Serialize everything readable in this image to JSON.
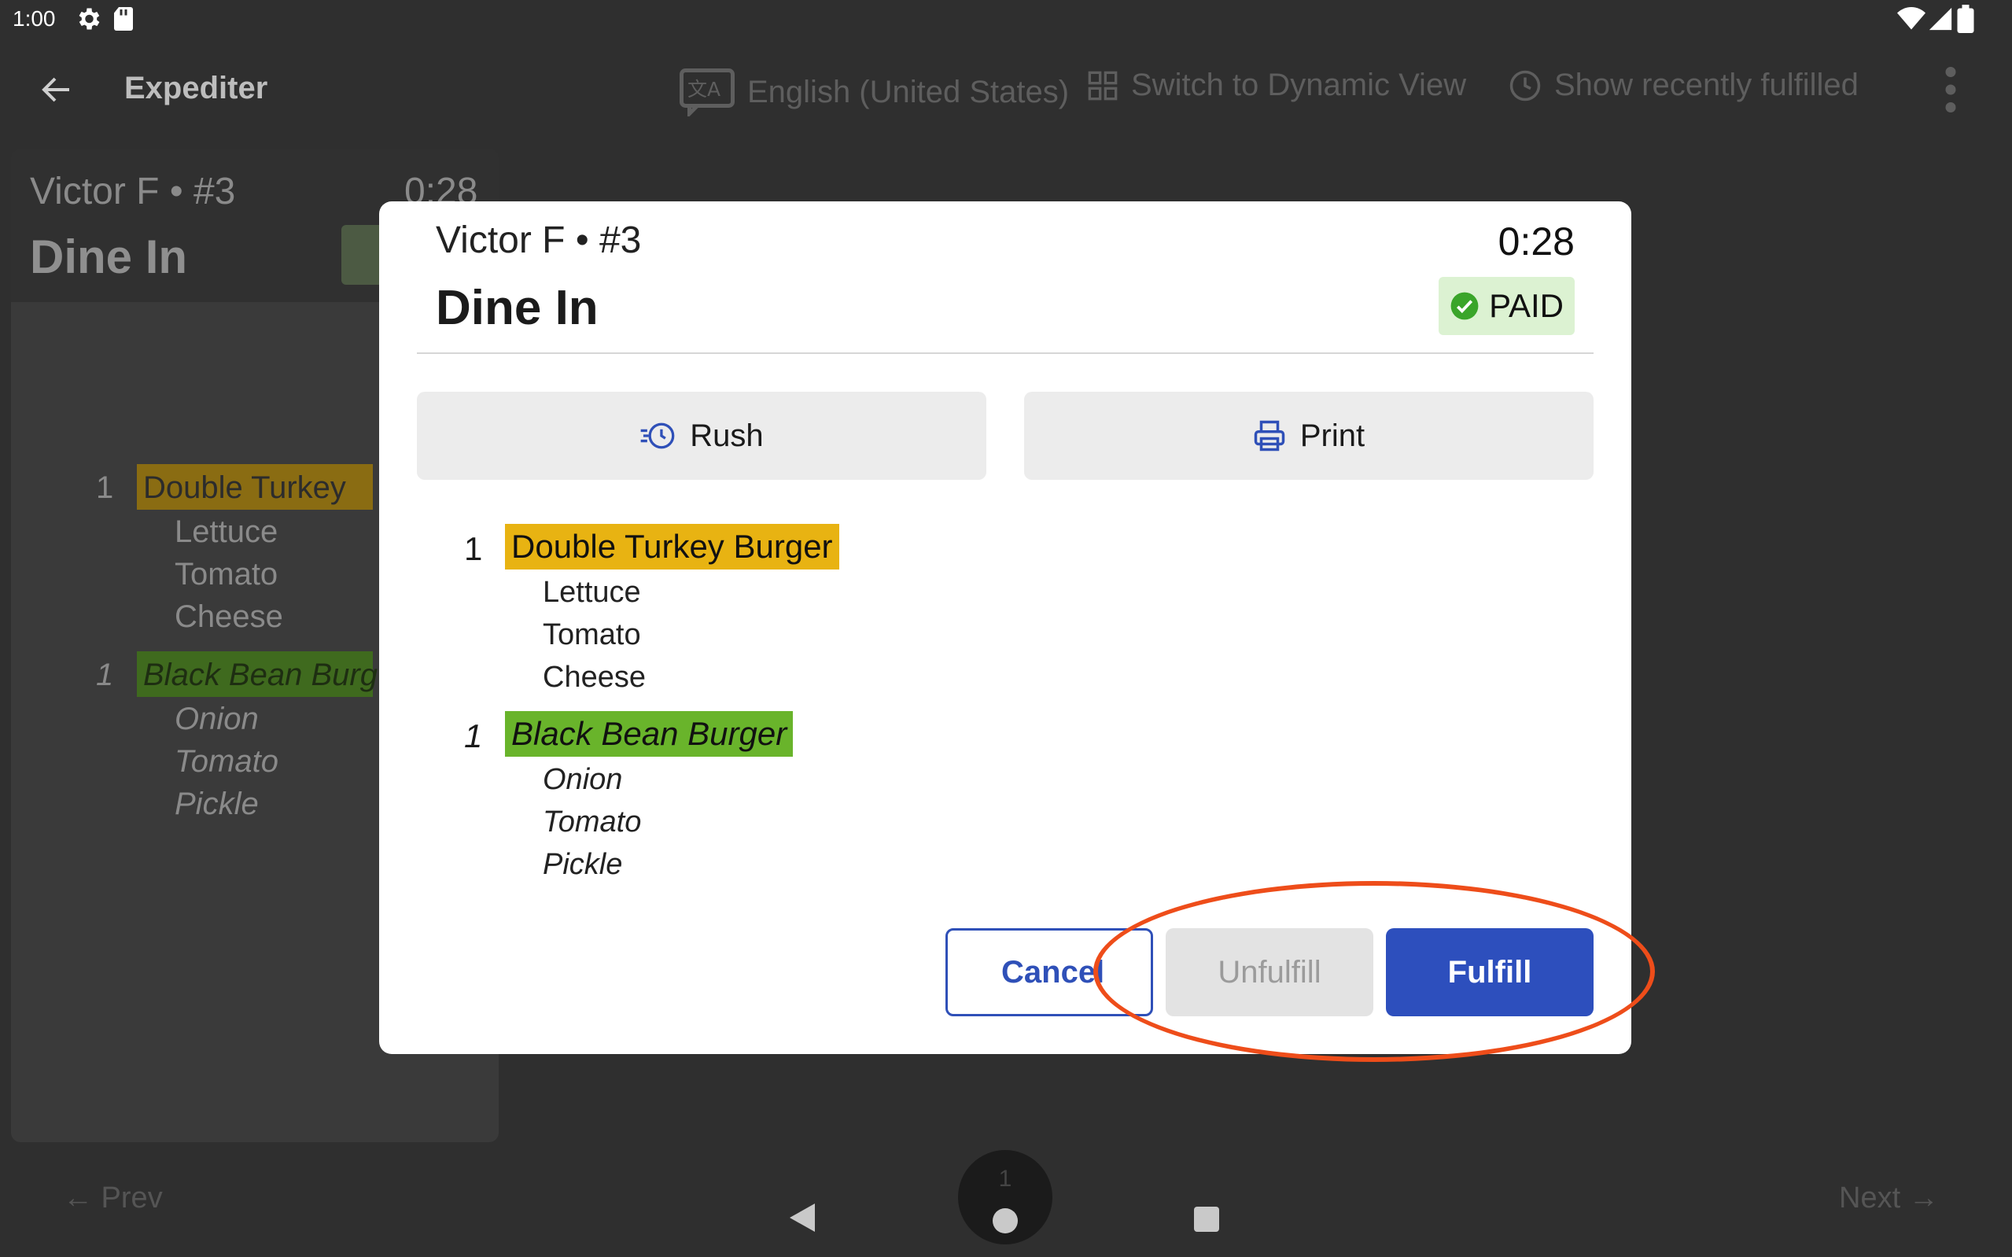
{
  "status_bar": {
    "time": "1:00"
  },
  "app_bar": {
    "title": "Expediter",
    "language": "English (United States)",
    "switch_view": "Switch to Dynamic View",
    "recent": "Show recently fulfilled"
  },
  "background_ticket": {
    "customer": "Victor F • #3",
    "timer": "0:28",
    "order_type": "Dine In",
    "items": [
      {
        "qty": "1",
        "name": "Double Turkey",
        "mods": [
          "Lettuce",
          "Tomato",
          "Cheese"
        ]
      },
      {
        "qty": "1",
        "name": "Black Bean Burg",
        "mods": [
          "Onion",
          "Tomato",
          "Pickle"
        ]
      }
    ]
  },
  "dialog": {
    "customer": "Victor F • #3",
    "timer": "0:28",
    "order_type": "Dine In",
    "paid_label": "PAID",
    "rush_label": "Rush",
    "print_label": "Print",
    "items": [
      {
        "qty": "1",
        "name": "Double Turkey Burger",
        "highlight": "#e8b312",
        "mods": [
          "Lettuce",
          "Tomato",
          "Cheese"
        ]
      },
      {
        "qty": "1",
        "name": "Black Bean Burger",
        "highlight": "#69b42b",
        "mods": [
          "Onion",
          "Tomato",
          "Pickle"
        ]
      }
    ],
    "cancel_label": "Cancel",
    "unfulfill_label": "Unfulfill",
    "fulfill_label": "Fulfill"
  },
  "bottom_nav": {
    "prev": "← Prev",
    "next": "Next →",
    "page": "1"
  },
  "colors": {
    "primary": "#2d4fbd",
    "paid_bg": "#dcf2d2",
    "annotation": "#ee4d1a"
  }
}
